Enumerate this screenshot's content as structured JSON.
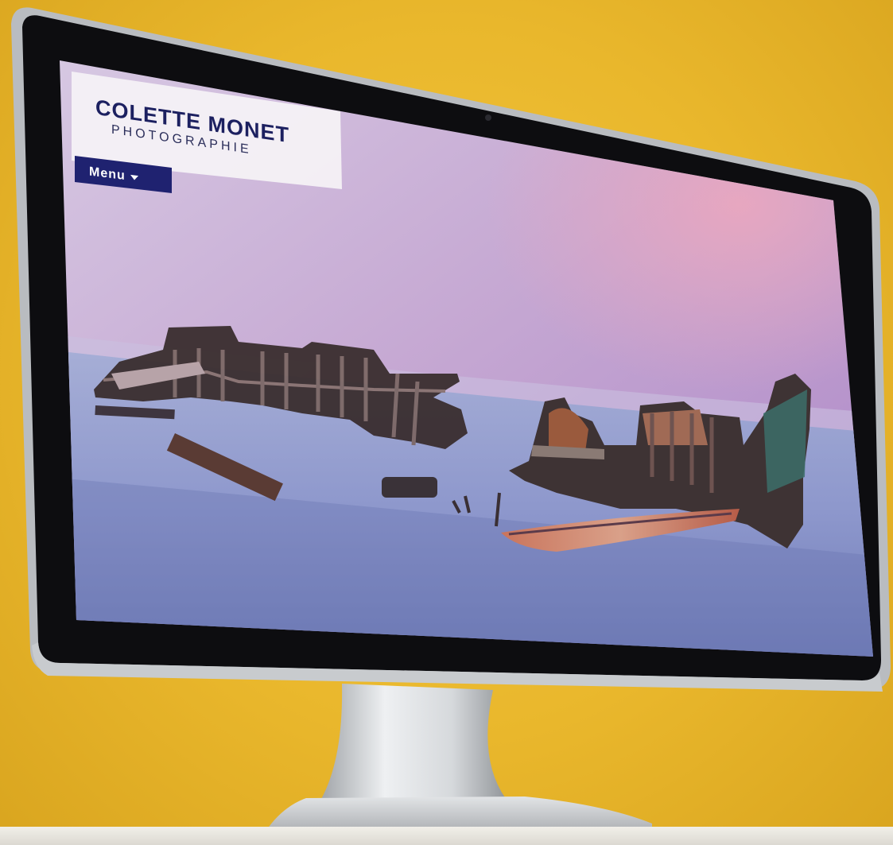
{
  "site": {
    "brand_line1": "COLETTE MONET",
    "brand_line2": "PHOTOGRAPHIE",
    "menu_label": "Menu",
    "menu_icon": "caret-down-icon",
    "hero_image": "shipwreck-at-dusk-photo"
  },
  "colors": {
    "background": "#eab930",
    "menu_button": "#1f2270",
    "brand_text": "#1c2060",
    "bezel": "#0d0d10"
  }
}
